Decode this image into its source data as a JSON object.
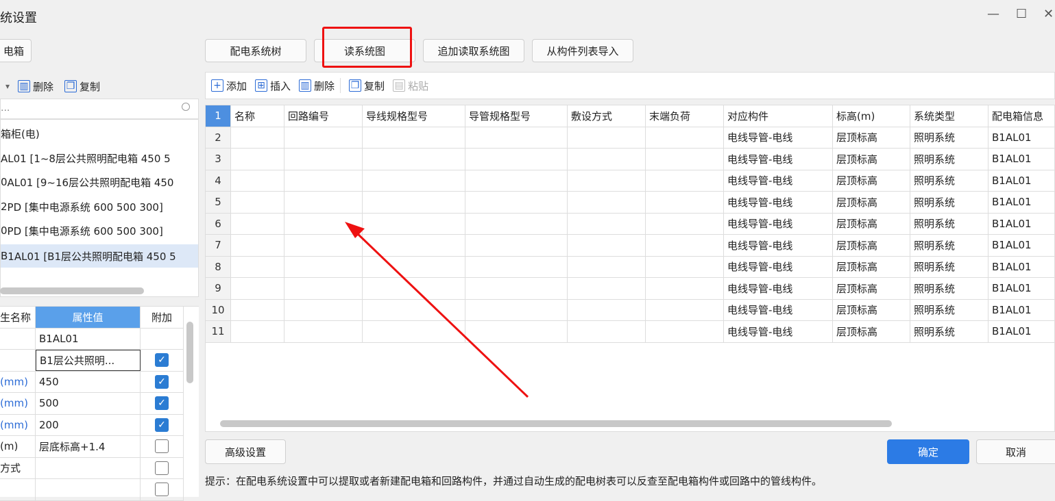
{
  "window": {
    "title": "统设置",
    "minimize": "—",
    "maximize": "☐",
    "close": "✕"
  },
  "left": {
    "box_button": "电箱",
    "toolbar": {
      "dropdown": "▾",
      "delete": "删除",
      "copy": "复制"
    },
    "search_placeholder": "...",
    "tree_items": [
      "箱柜(电)",
      "AL01 [1~8层公共照明配电箱 450 5",
      "AL01 [9~16层公共照明配电箱 450",
      "PD [集中电源系统 600 500 300]",
      "PD [集中电源系统 600 500 300]",
      "1AL01 [B1层公共照明配电箱 450 5"
    ],
    "tree_prefix": [
      "",
      "",
      "0",
      "2",
      "0",
      "B"
    ],
    "props": {
      "headers": [
        "生名称",
        "属性值",
        "附加"
      ],
      "rows": [
        {
          "name": "",
          "value": "B1AL01",
          "checked": null
        },
        {
          "name": "",
          "value": "B1层公共照明...",
          "checked": true
        },
        {
          "name": "(mm)",
          "value": "450",
          "checked": true
        },
        {
          "name": "(mm)",
          "value": "500",
          "checked": true
        },
        {
          "name": "(mm)",
          "value": "200",
          "checked": true
        },
        {
          "name": "(m)",
          "value": "层底标高+1.4",
          "checked": false
        },
        {
          "name": "方式",
          "value": "",
          "checked": false
        },
        {
          "name": "",
          "value": "",
          "checked": false
        }
      ]
    }
  },
  "top_buttons": [
    "配电系统树",
    "读系统图",
    "追加读取系统图",
    "从构件列表导入"
  ],
  "right_toolbar": {
    "add": "添加",
    "insert": "插入",
    "delete": "删除",
    "copy": "复制",
    "paste": "粘贴"
  },
  "grid": {
    "headers": [
      "名称",
      "回路编号",
      "导线规格型号",
      "导管规格型号",
      "敷设方式",
      "末端负荷",
      "对应构件",
      "标高(m)",
      "系统类型",
      "配电箱信息"
    ],
    "row_numbers": [
      "1",
      "2",
      "3",
      "4",
      "5",
      "6",
      "7",
      "8",
      "9",
      "10",
      "11"
    ],
    "rows": [
      [
        "",
        "",
        "",
        "",
        "",
        "",
        "电线导管-电线",
        "层顶标高",
        "照明系统",
        "B1AL01"
      ],
      [
        "",
        "",
        "",
        "",
        "",
        "",
        "电线导管-电线",
        "层顶标高",
        "照明系统",
        "B1AL01"
      ],
      [
        "",
        "",
        "",
        "",
        "",
        "",
        "电线导管-电线",
        "层顶标高",
        "照明系统",
        "B1AL01"
      ],
      [
        "",
        "",
        "",
        "",
        "",
        "",
        "电线导管-电线",
        "层顶标高",
        "照明系统",
        "B1AL01"
      ],
      [
        "",
        "",
        "",
        "",
        "",
        "",
        "电线导管-电线",
        "层顶标高",
        "照明系统",
        "B1AL01"
      ],
      [
        "",
        "",
        "",
        "",
        "",
        "",
        "电线导管-电线",
        "层顶标高",
        "照明系统",
        "B1AL01"
      ],
      [
        "",
        "",
        "",
        "",
        "",
        "",
        "电线导管-电线",
        "层顶标高",
        "照明系统",
        "B1AL01"
      ],
      [
        "",
        "",
        "",
        "",
        "",
        "",
        "电线导管-电线",
        "层顶标高",
        "照明系统",
        "B1AL01"
      ],
      [
        "",
        "",
        "",
        "",
        "",
        "",
        "电线导管-电线",
        "层顶标高",
        "照明系统",
        "B1AL01"
      ],
      [
        "",
        "",
        "",
        "",
        "",
        "",
        "电线导管-电线",
        "层顶标高",
        "照明系统",
        "B1AL01"
      ]
    ]
  },
  "footer": {
    "advanced": "高级设置",
    "ok": "确定",
    "cancel": "取消",
    "hint": "提示：在配电系统设置中可以提取或者新建配电箱和回路构件，并通过自动生成的配电树表可以反查至配电箱构件或回路中的管线构件。"
  },
  "colors": {
    "accent": "#2c7be5",
    "annotation_red": "#e11111",
    "header_blue": "#5aa0ea"
  }
}
